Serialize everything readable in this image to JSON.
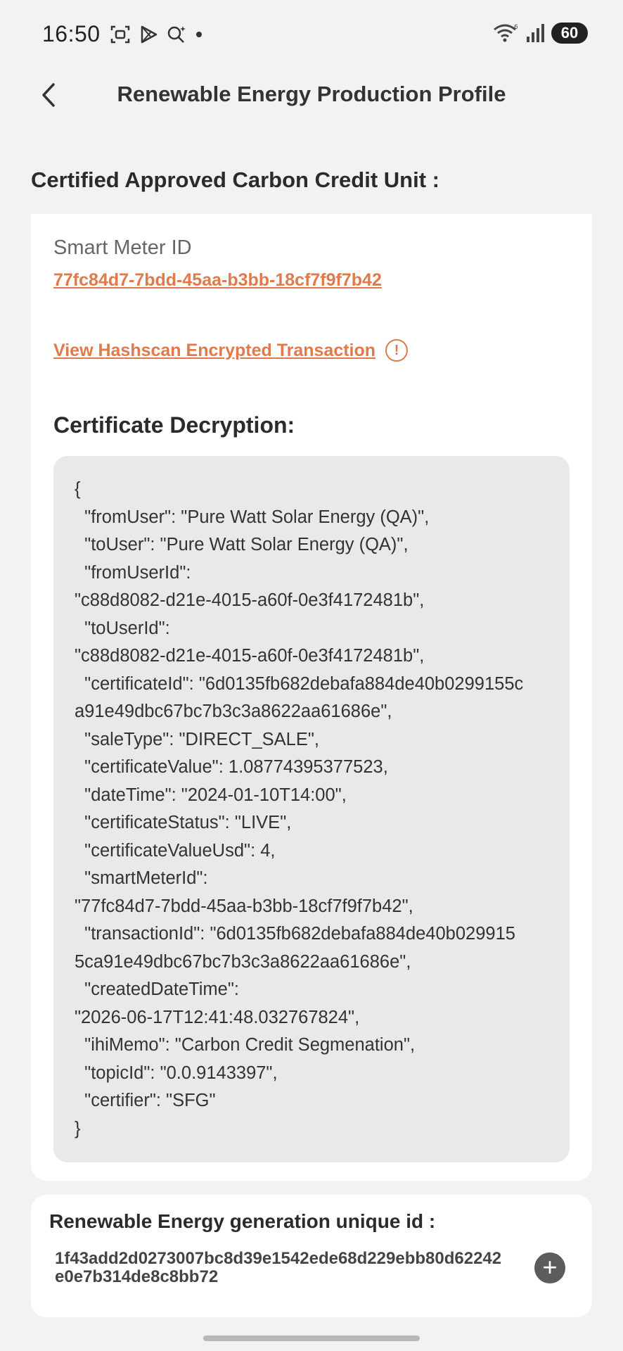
{
  "status_bar": {
    "time": "16:50",
    "battery": "60"
  },
  "header": {
    "title": "Renewable Energy Production Profile"
  },
  "section": {
    "title": "Certified Approved Carbon Credit Unit :"
  },
  "meter": {
    "label": "Smart Meter ID",
    "id": "77fc84d7-7bdd-45aa-b3bb-18cf7f9f7b42"
  },
  "hashscan": {
    "link_label": "View Hashscan Encrypted Transaction"
  },
  "decryption": {
    "title": "Certificate Decryption:",
    "lines": [
      "{",
      "  \"fromUser\": \"Pure Watt Solar Energy (QA)\",",
      "  \"toUser\": \"Pure Watt Solar Energy (QA)\",",
      "  \"fromUserId\":",
      "\"c88d8082-d21e-4015-a60f-0e3f4172481b\",",
      "  \"toUserId\":",
      "\"c88d8082-d21e-4015-a60f-0e3f4172481b\",",
      "  \"certificateId\": \"6d0135fb682debafa884de40b0299155c",
      "a91e49dbc67bc7b3c3a8622aa61686e\",",
      "  \"saleType\": \"DIRECT_SALE\",",
      "  \"certificateValue\": 1.08774395377523,",
      "  \"dateTime\": \"2024-01-10T14:00\",",
      "  \"certificateStatus\": \"LIVE\",",
      "  \"certificateValueUsd\": 4,",
      "  \"smartMeterId\":",
      "\"77fc84d7-7bdd-45aa-b3bb-18cf7f9f7b42\",",
      "  \"transactionId\": \"6d0135fb682debafa884de40b029915",
      "5ca91e49dbc67bc7b3c3a8622aa61686e\",",
      "  \"createdDateTime\":",
      "\"2026-06-17T12:41:48.032767824\",",
      "  \"ihiMemo\": \"Carbon Credit Segmenation\",",
      "  \"topicId\": \"0.0.9143397\",",
      "  \"certifier\": \"SFG\"",
      "}"
    ]
  },
  "generation": {
    "title": "Renewable Energy generation unique id :",
    "id": "1f43add2d0273007bc8d39e1542ede68d229ebb80d62242e0e7b314de8c8bb72",
    "add_label": "+"
  }
}
